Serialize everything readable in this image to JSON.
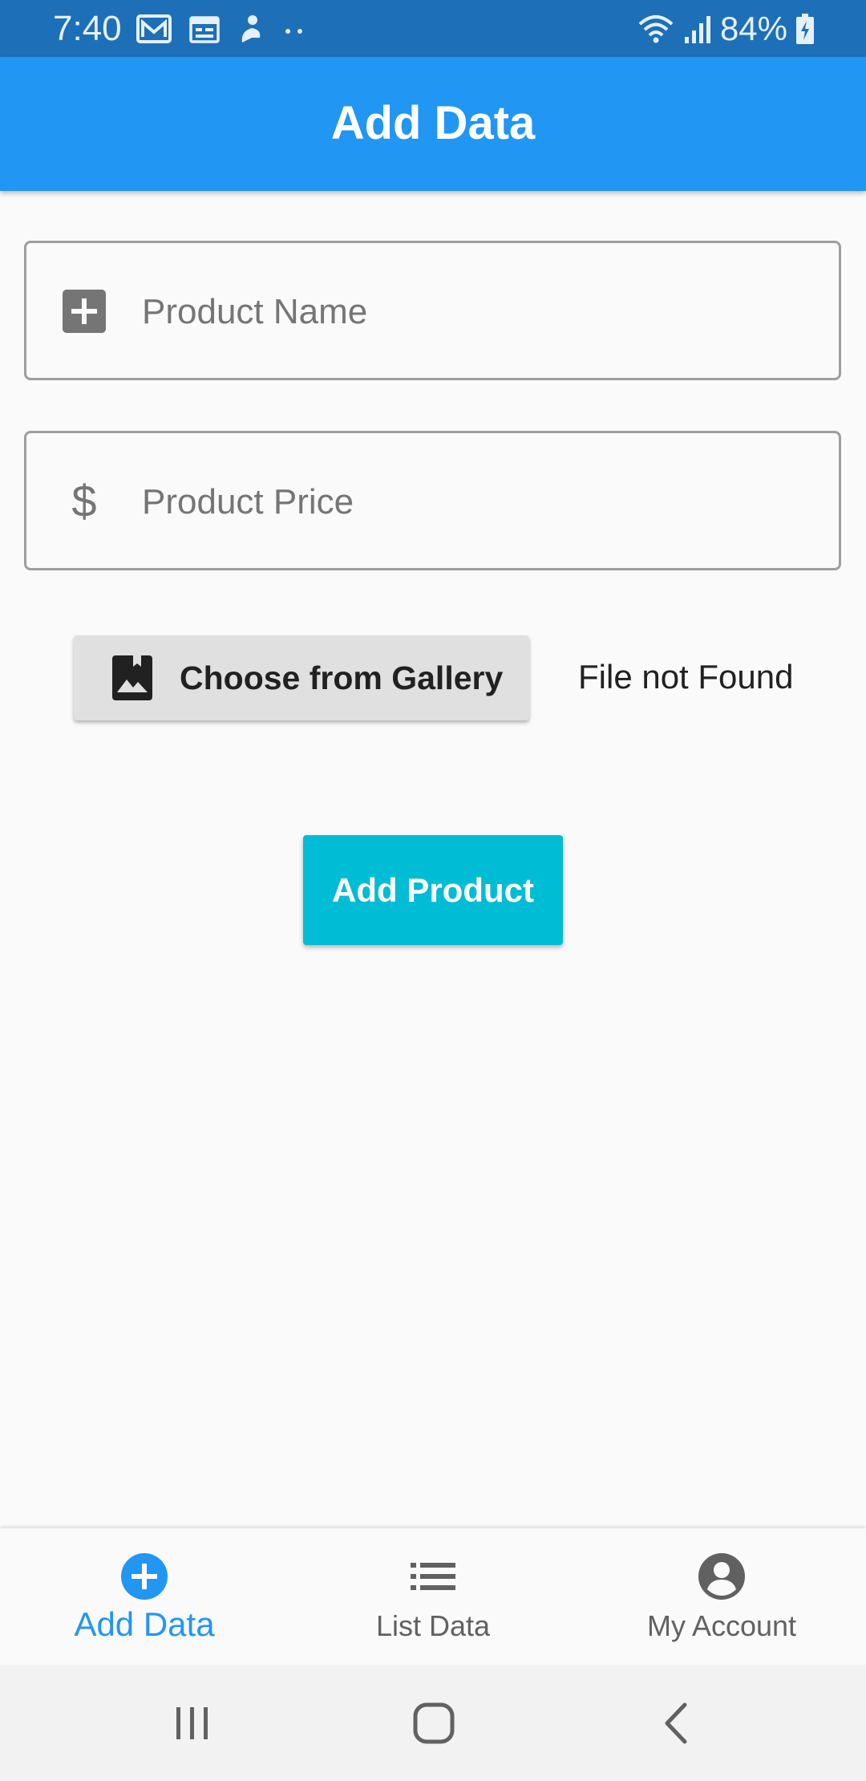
{
  "status_bar": {
    "time": "7:40",
    "battery": "84%",
    "icons": [
      "gmail-icon",
      "calendar-icon",
      "person-icon",
      "more-dots-icon",
      "wifi-icon",
      "signal-icon",
      "battery-charging-icon"
    ]
  },
  "app_bar": {
    "title": "Add Data",
    "color": "#2196f3"
  },
  "form": {
    "product_name": {
      "value": "",
      "placeholder": "Product Name",
      "icon": "add-box-icon"
    },
    "product_price": {
      "value": "",
      "placeholder": "Product Price",
      "icon": "dollar-icon",
      "icon_glyph": "$"
    },
    "gallery_button": {
      "label": "Choose from Gallery",
      "icon": "photo-album-icon"
    },
    "file_status": "File not Found",
    "submit_button": {
      "label": "Add Product",
      "color": "#00bcd4"
    }
  },
  "bottom_nav": {
    "items": [
      {
        "label": "Add Data",
        "icon": "add-circle-icon",
        "active": true
      },
      {
        "label": "List Data",
        "icon": "list-icon",
        "active": false
      },
      {
        "label": "My Account",
        "icon": "account-circle-icon",
        "active": false
      }
    ],
    "active_color": "#2196f3"
  },
  "system_nav": {
    "buttons": [
      "recent-apps-icon",
      "home-icon",
      "back-icon"
    ]
  }
}
